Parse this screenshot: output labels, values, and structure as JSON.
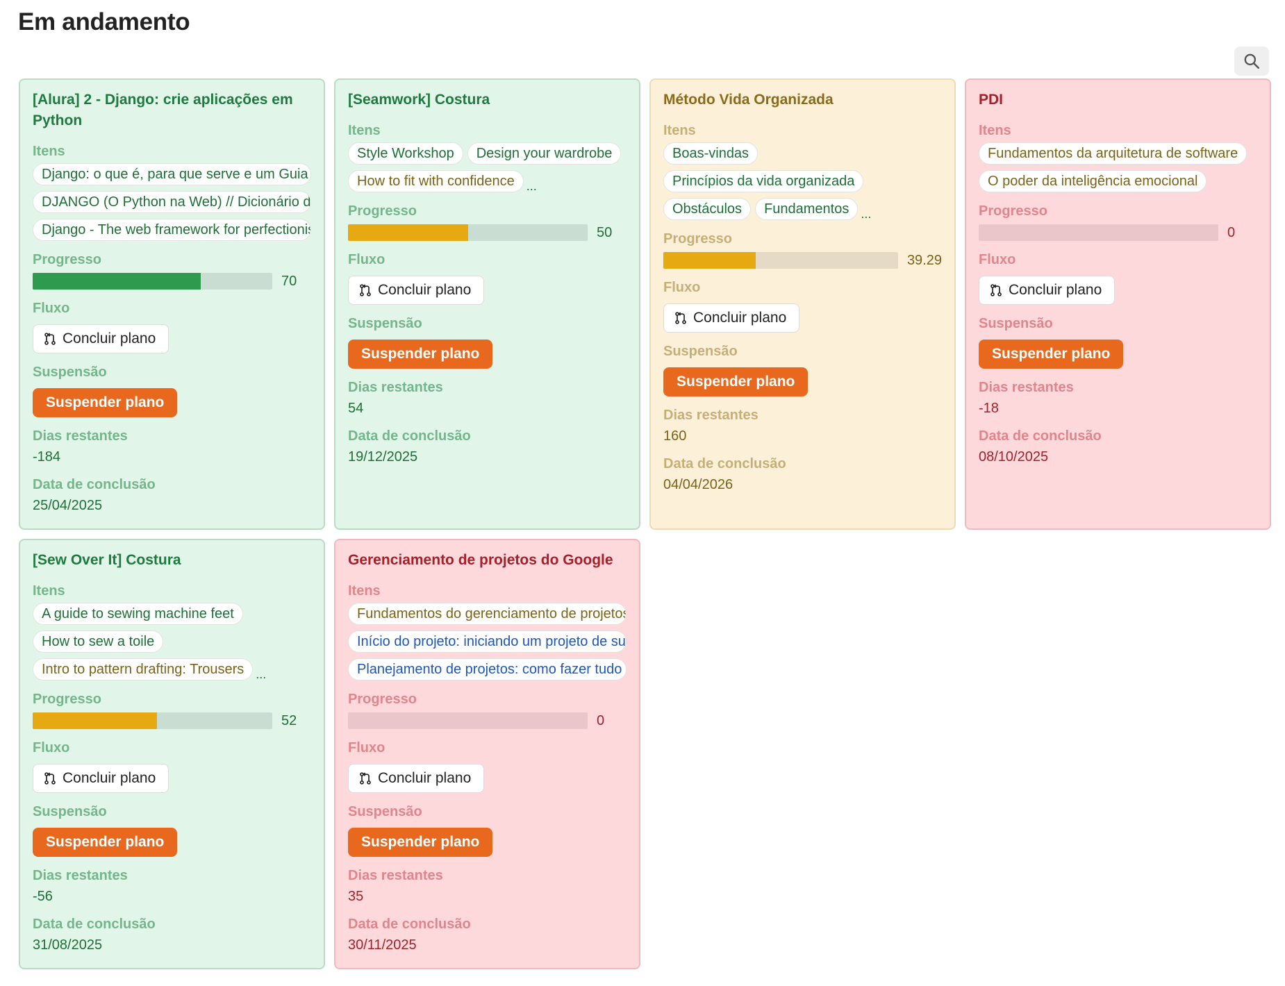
{
  "page": {
    "title": "Em andamento"
  },
  "labels": {
    "items": "Itens",
    "progress": "Progresso",
    "flow": "Fluxo",
    "suspension": "Suspensão",
    "days_left": "Dias restantes",
    "completion_date": "Data de conclusão",
    "complete_button": "Concluir plano",
    "suspend_button": "Suspender plano",
    "more": "..."
  },
  "icons": {
    "search": "search-icon",
    "flow": "git-merge-icon"
  },
  "colors": {
    "green_card": "#e2f5e9",
    "yellow_card": "#fcf1d8",
    "red_card": "#fdd9dc",
    "progress_green": "#2e9a4d",
    "progress_yellow": "#e6a911",
    "suspend_button": "#e8681d"
  },
  "cards": [
    {
      "title": "[Alura] 2 - Django: crie aplicações em Python",
      "theme": "green",
      "items": [
        {
          "text": "Django: o que é, para que serve e um Guia",
          "color": "green"
        },
        {
          "text": "DJANGO (O Python na Web) // Dicionário do Programador",
          "color": "green"
        },
        {
          "text": "Django - The web framework for perfectionists with deadlines",
          "color": "green"
        }
      ],
      "more": false,
      "progress": "70",
      "progress_value": 70,
      "days_left": "-184",
      "completion_date": "25/04/2025"
    },
    {
      "title": "[Seamwork] Costura",
      "theme": "green",
      "items": [
        {
          "text": "Style Workshop",
          "color": "green"
        },
        {
          "text": "Design your wardrobe",
          "color": "green"
        },
        {
          "text": "How to fit with confidence",
          "color": "olive"
        }
      ],
      "more": true,
      "progress": "50",
      "progress_value": 50,
      "days_left": "54",
      "completion_date": "19/12/2025"
    },
    {
      "title": "Método Vida Organizada",
      "theme": "yellow",
      "items": [
        {
          "text": "Boas-vindas",
          "color": "green"
        },
        {
          "text": "Princípios da vida organizada",
          "color": "green"
        },
        {
          "text": "Obstáculos",
          "color": "green"
        },
        {
          "text": "Fundamentos",
          "color": "green"
        }
      ],
      "more": true,
      "progress": "39.29",
      "progress_value": 39.29,
      "days_left": "160",
      "completion_date": "04/04/2026"
    },
    {
      "title": "PDI",
      "theme": "red",
      "items": [
        {
          "text": "Fundamentos da arquitetura de software",
          "color": "olive"
        },
        {
          "text": "O poder da inteligência emocional",
          "color": "olive"
        }
      ],
      "more": false,
      "progress": "0",
      "progress_value": 0,
      "days_left": "-18",
      "completion_date": "08/10/2025"
    },
    {
      "title": "[Sew Over It] Costura",
      "theme": "green",
      "items": [
        {
          "text": "A guide to sewing machine feet",
          "color": "green"
        },
        {
          "text": "How to sew a toile",
          "color": "green"
        },
        {
          "text": "Intro to pattern drafting: Trousers",
          "color": "olive"
        }
      ],
      "more": true,
      "progress": "52",
      "progress_value": 52,
      "days_left": "-56",
      "completion_date": "31/08/2025"
    },
    {
      "title": "Gerenciamento de projetos do Google",
      "theme": "red",
      "items": [
        {
          "text": "Fundamentos do gerenciamento de projetos",
          "color": "olive"
        },
        {
          "text": "Início do projeto: iniciando um projeto de sucesso",
          "color": "blue"
        },
        {
          "text": "Planejamento de projetos: como fazer tudo",
          "color": "blue"
        }
      ],
      "more": false,
      "progress": "0",
      "progress_value": 0,
      "days_left": "35",
      "completion_date": "30/11/2025"
    }
  ]
}
